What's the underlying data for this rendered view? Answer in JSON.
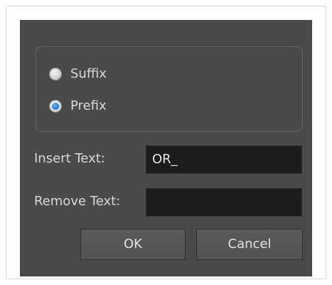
{
  "dialog": {
    "affix_options": [
      {
        "label": "Suffix",
        "selected": false
      },
      {
        "label": "Prefix",
        "selected": true
      }
    ],
    "insert_text": {
      "label": "Insert Text:",
      "value": "OR_"
    },
    "remove_text": {
      "label": "Remove Text:",
      "value": ""
    },
    "buttons": {
      "ok_label": "OK",
      "cancel_label": "Cancel"
    }
  },
  "colors": {
    "dialog_background": "#4a4a4a",
    "field_background": "#1c1c1c",
    "radio_selected_dot": "#1f72c9"
  }
}
